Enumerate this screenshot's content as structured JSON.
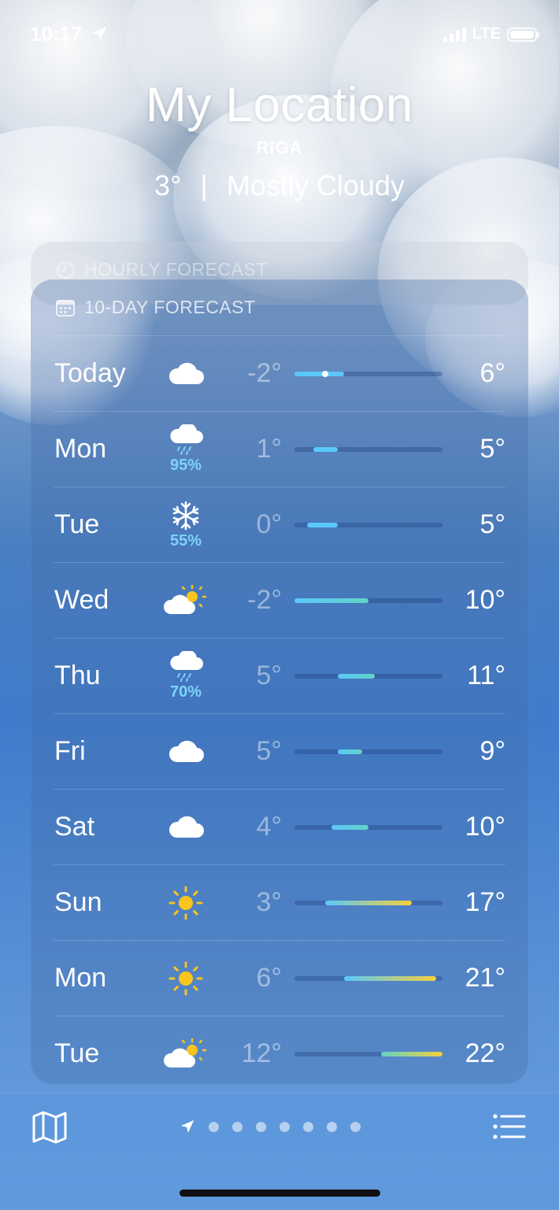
{
  "status_bar": {
    "time": "10:17",
    "network": "LTE"
  },
  "header": {
    "title": "My Location",
    "city": "RIGA",
    "current_temp": "3°",
    "separator": "|",
    "condition": "Mostly Cloudy"
  },
  "hourly": {
    "label": "HOURLY FORECAST"
  },
  "forecast": {
    "label": "10-DAY FORECAST",
    "range_min": -2,
    "range_max": 22,
    "current_temp_value": 3,
    "days": [
      {
        "day": "Today",
        "icon": "cloud-icon",
        "precip": "",
        "low": "-2°",
        "high": "6°",
        "low_value": -2,
        "high_value": 6
      },
      {
        "day": "Mon",
        "icon": "rain-cloud-icon",
        "precip": "95%",
        "low": "1°",
        "high": "5°",
        "low_value": 1,
        "high_value": 5
      },
      {
        "day": "Tue",
        "icon": "snowflake-icon",
        "precip": "55%",
        "low": "0°",
        "high": "5°",
        "low_value": 0,
        "high_value": 5
      },
      {
        "day": "Wed",
        "icon": "partly-sunny-icon",
        "precip": "",
        "low": "-2°",
        "high": "10°",
        "low_value": -2,
        "high_value": 10
      },
      {
        "day": "Thu",
        "icon": "rain-cloud-icon",
        "precip": "70%",
        "low": "5°",
        "high": "11°",
        "low_value": 5,
        "high_value": 11
      },
      {
        "day": "Fri",
        "icon": "cloud-icon",
        "precip": "",
        "low": "5°",
        "high": "9°",
        "low_value": 5,
        "high_value": 9
      },
      {
        "day": "Sat",
        "icon": "cloud-icon",
        "precip": "",
        "low": "4°",
        "high": "10°",
        "low_value": 4,
        "high_value": 10
      },
      {
        "day": "Sun",
        "icon": "sun-icon",
        "precip": "",
        "low": "3°",
        "high": "17°",
        "low_value": 3,
        "high_value": 17
      },
      {
        "day": "Mon",
        "icon": "sun-icon",
        "precip": "",
        "low": "6°",
        "high": "21°",
        "low_value": 6,
        "high_value": 21
      },
      {
        "day": "Tue",
        "icon": "partly-sunny-icon",
        "precip": "",
        "low": "12°",
        "high": "22°",
        "low_value": 12,
        "high_value": 22
      }
    ]
  },
  "colors": {
    "cold": "#5ac8fa",
    "mild": "#63d2c8",
    "warm": "#f5d03b",
    "precip": "#7dd3fb",
    "sun": "#f7c51e"
  },
  "bottom_bar": {
    "page_count": 7,
    "active_page": "current-location"
  }
}
